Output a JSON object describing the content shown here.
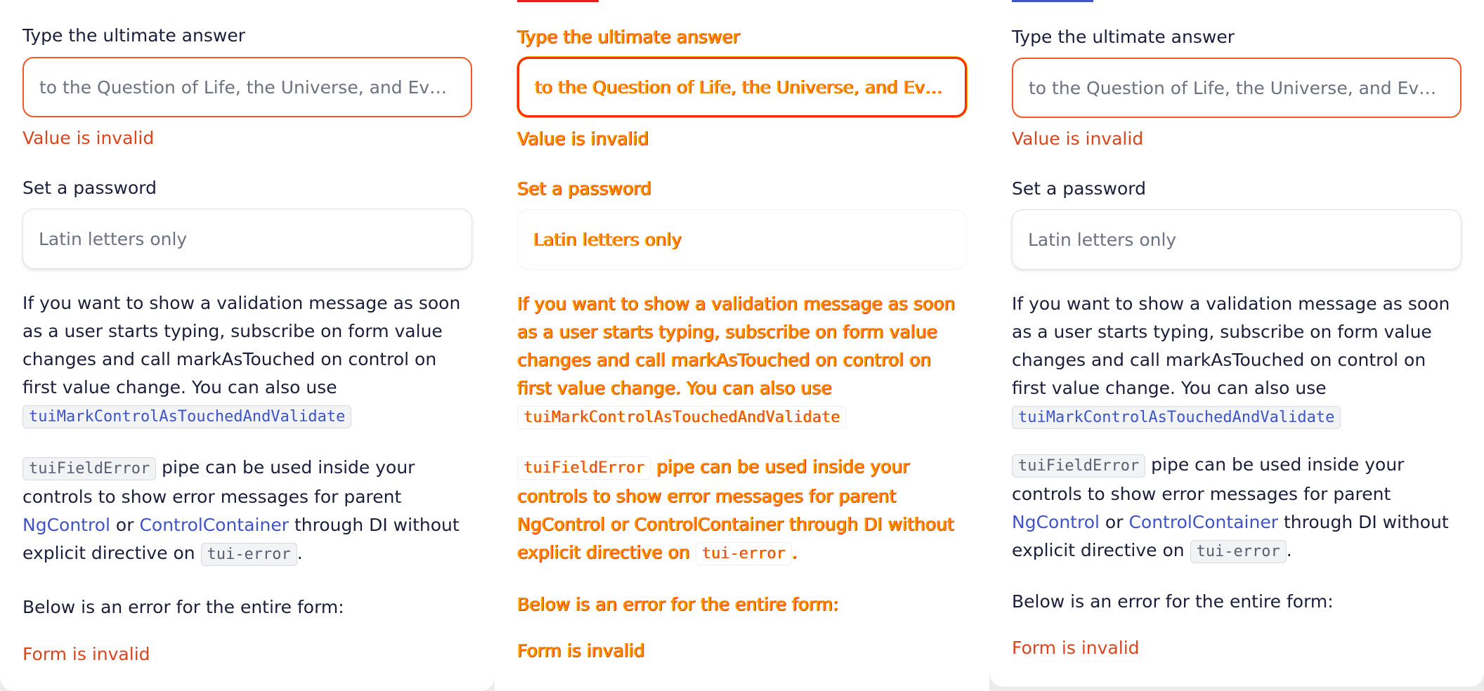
{
  "colors": {
    "accent_left": "#e0441c",
    "accent_middle": "#e81c1c",
    "accent_right": "#3f54c7",
    "error": "#e0441c",
    "link": "#3f54c7"
  },
  "panels": [
    {
      "answer_field": {
        "label": "Type the ultimate answer",
        "placeholder": "to the Question of Life, the Universe, and Everything",
        "error": "Value is invalid"
      },
      "password_field": {
        "label": "Set a password",
        "placeholder": "Latin letters only"
      },
      "description": {
        "text_1": "If you want to show a validation message as soon as a user starts typing, subscribe on form value changes and call markAsTouched on control on first value change. You can also use",
        "code_1": "tuiMarkControlAsTouchedAndValidate",
        "code_2": "tuiFieldError",
        "text_2": "pipe can be used inside your controls to show error messages for parent",
        "link_1": "NgControl",
        "text_3": "or",
        "link_2": "ControlContainer",
        "text_4": "through DI without explicit directive on",
        "code_3": "tui-error",
        "text_5": "."
      },
      "form_error_note": "Below is an error for the entire form:",
      "form_error": "Form is invalid"
    },
    {
      "answer_field": {
        "label": "Type the ultimate answer",
        "placeholder": "to the Question of Life, the Universe, and Everything",
        "error": "Value is invalid"
      },
      "password_field": {
        "label": "Set a password",
        "placeholder": "Latin letters only"
      },
      "description": {
        "text_1": "If you want to show a validation message as soon as a user starts typing, subscribe on form value changes and call markAsTouched on control on first value change. You can also use",
        "code_1": "tuiMarkControlAsTouchedAndValidate",
        "code_2": "tuiFieldError",
        "text_2": "pipe can be used inside your controls to show error messages for parent",
        "link_1": "NgControl",
        "text_3": "or",
        "link_2": "ControlContainer",
        "text_4": "through DI without explicit directive on",
        "code_3": "tui-error",
        "text_5": "."
      },
      "form_error_note": "Below is an error for the entire form:",
      "form_error": "Form is invalid"
    },
    {
      "answer_field": {
        "label": "Type the ultimate answer",
        "placeholder": "to the Question of Life, the Universe, and Everything",
        "error": "Value is invalid"
      },
      "password_field": {
        "label": "Set a password",
        "placeholder": "Latin letters only"
      },
      "description": {
        "text_1": "If you want to show a validation message as soon as a user starts typing, subscribe on form value changes and call markAsTouched on control on first value change. You can also use",
        "code_1": "tuiMarkControlAsTouchedAndValidate",
        "code_2": "tuiFieldError",
        "text_2": "pipe can be used inside your controls to show error messages for parent",
        "link_1": "NgControl",
        "text_3": "or",
        "link_2": "ControlContainer",
        "text_4": "through DI without explicit directive on",
        "code_3": "tui-error",
        "text_5": "."
      },
      "form_error_note": "Below is an error for the entire form:",
      "form_error": "Form is invalid"
    }
  ]
}
